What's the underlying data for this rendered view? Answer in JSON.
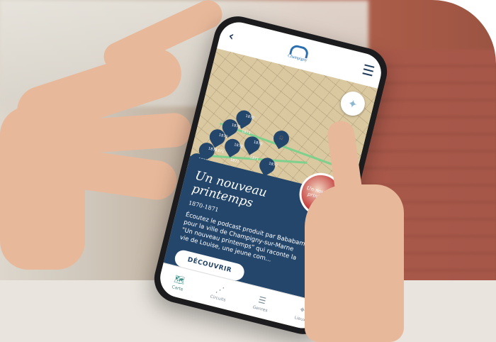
{
  "header": {
    "back_icon": "chevron-left-icon",
    "logo_text": "Champigny",
    "menu_icon": "hamburger-icon"
  },
  "map": {
    "compass_icon": "compass-icon",
    "pins": [
      {
        "label": "1870\n1871"
      },
      {
        "label": "1870\n1871"
      },
      {
        "label": "1870\n1871"
      },
      {
        "label": "1870\n1871"
      },
      {
        "label": "1870\n1871"
      },
      {
        "label": "1870\n1871"
      },
      {
        "label": "1870\n1871"
      },
      {
        "label": "1870\n1871"
      }
    ]
  },
  "card": {
    "title": "Un nouveau printemps",
    "years": "1870-1871",
    "description": "Écoutez le podcast produit par Bababam pour la ville de Champigny-sur-Marne \"Un nouveau printemps\" qui raconte la vie de Louise, une jeune com...",
    "cta_label": "DÉCOUVRIR",
    "thumbnail_text": "Un nouveau printemps"
  },
  "tabs": [
    {
      "label": "Carte",
      "icon": "map-icon",
      "active": true
    },
    {
      "label": "Circuits",
      "icon": "route-icon",
      "active": false
    },
    {
      "label": "Genres",
      "icon": "list-icon",
      "active": false
    },
    {
      "label": "Lieux",
      "icon": "location-pin-icon",
      "active": false
    }
  ],
  "colors": {
    "card_background": "#24466b",
    "route": "#7ed08d",
    "active_tab": "#3f8f86"
  }
}
